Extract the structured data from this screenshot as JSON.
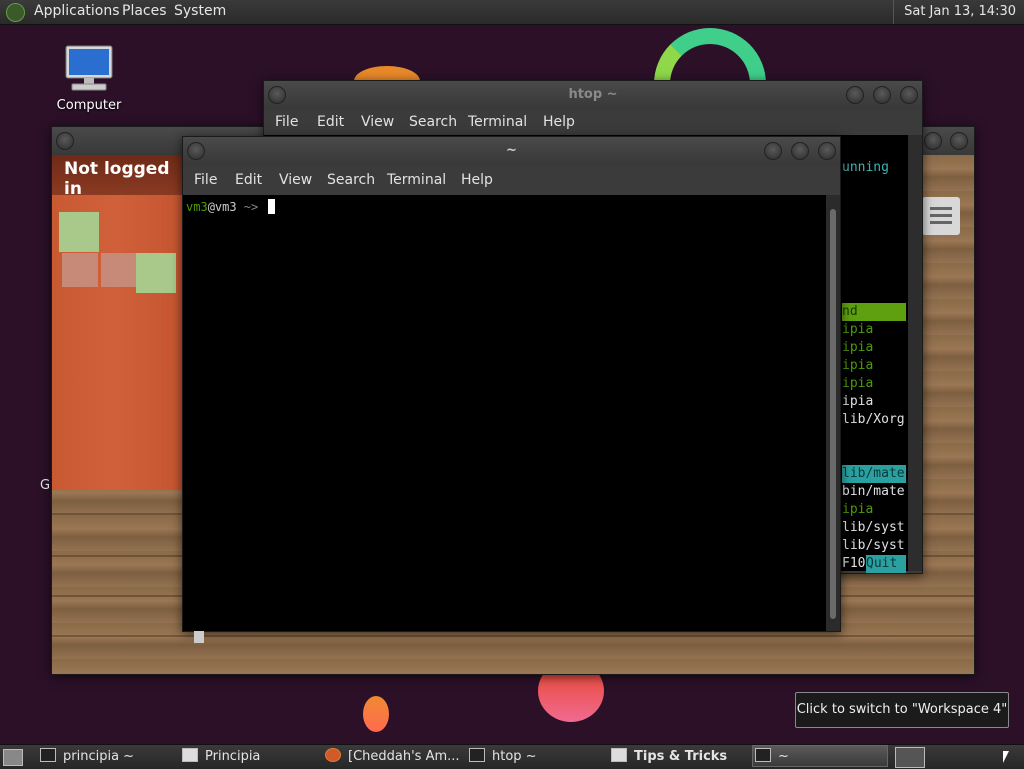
{
  "top_panel": {
    "menus": [
      "Applications",
      "Places",
      "System"
    ],
    "clock": "Sat Jan 13, 14:30"
  },
  "desktop": {
    "icons": [
      {
        "label": "Computer",
        "icon": "computer-icon"
      }
    ],
    "stray_text": "G"
  },
  "game_window": {
    "status": "Not logged in"
  },
  "htop_window": {
    "title": "htop ~",
    "menu": [
      "File",
      "Edit",
      "View",
      "Search",
      "Terminal",
      "Help"
    ],
    "visible_lines": [
      {
        "text": "unning",
        "color": "#3fb3b3",
        "bg": ""
      },
      {
        "text": "nd",
        "color": "#1a3a00",
        "bg": "#5ea010"
      },
      {
        "text": "ipia",
        "color": "#4e9a06",
        "bg": ""
      },
      {
        "text": "ipia",
        "color": "#4e9a06",
        "bg": ""
      },
      {
        "text": "ipia",
        "color": "#4e9a06",
        "bg": ""
      },
      {
        "text": "ipia",
        "color": "#4e9a06",
        "bg": ""
      },
      {
        "text": "ipia",
        "color": "#e0e0e0",
        "bg": ""
      },
      {
        "text": "lib/Xorg",
        "color": "#e0e0e0",
        "bg": ""
      },
      {
        "text": "lib/mate",
        "color": "#0a3a3a",
        "bg": "#2aa0a0"
      },
      {
        "text": "bin/mate",
        "color": "#e0e0e0",
        "bg": ""
      },
      {
        "text": "ipia",
        "color": "#4e9a06",
        "bg": ""
      },
      {
        "text": "lib/syst",
        "color": "#e0e0e0",
        "bg": ""
      },
      {
        "text": "lib/syst",
        "color": "#e0e0e0",
        "bg": ""
      },
      {
        "text": "F10",
        "color": "#e0e0e0",
        "bg": ""
      }
    ],
    "quit_label": "Quit"
  },
  "terminal_window": {
    "title": "~",
    "menu": [
      "File",
      "Edit",
      "View",
      "Search",
      "Terminal",
      "Help"
    ],
    "prompt_user": "vm3",
    "prompt_host": "@vm3",
    "prompt_arrow": " ~> "
  },
  "tooltip": "Click to switch to \"Workspace 4\"",
  "taskbar": {
    "tasks": [
      {
        "label": "principia ~",
        "icon": "terminal-icon"
      },
      {
        "label": "Principia",
        "icon": "window-icon"
      },
      {
        "label": "[Cheddah's Am...",
        "icon": "firefox-icon"
      },
      {
        "label": "htop ~",
        "icon": "terminal-icon"
      },
      {
        "label": "Tips & Tricks",
        "icon": "window-icon"
      },
      {
        "label": "~",
        "icon": "terminal-icon"
      }
    ]
  },
  "colors": {
    "desktop_bg": "#2b1028",
    "prompt_user": "#4e9a06",
    "htop_green": "#5ea010",
    "htop_cyan": "#2aa0a0"
  }
}
